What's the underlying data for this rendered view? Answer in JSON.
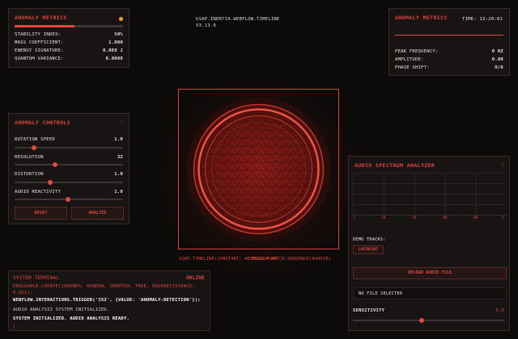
{
  "metrics_left": {
    "title": "Anomaly Metrics",
    "progress": 0.55,
    "rows": [
      {
        "label": "Stability Index:",
        "value": "50%"
      },
      {
        "label": "Mass Coefficient:",
        "value": "1.000"
      },
      {
        "label": "Energy Signature:",
        "value": "0.0E0 J"
      },
      {
        "label": "Quantum Variance:",
        "value": "0.0000"
      }
    ]
  },
  "header_center": {
    "line1": "GSAP.INERTIA.WEBFLOW.TIMELINE",
    "line2": "V3.13.0"
  },
  "metrics_right": {
    "title": "Anomaly Metrics",
    "time_label": "Time: 13:20:01",
    "rows": [
      {
        "label": "Peak Frequency:",
        "value": "0 Hz"
      },
      {
        "label": "Amplitude:",
        "value": "0.00"
      },
      {
        "label": "Phase Shift:",
        "value": "π/6"
      }
    ]
  },
  "controls": {
    "title": "Anomaly Controls",
    "grip": "⠿",
    "sliders": [
      {
        "label": "Rotation Speed",
        "value": "1.0",
        "fraction": 0.18
      },
      {
        "label": "Resolution",
        "value": "32",
        "fraction": 0.37
      },
      {
        "label": "Distortion",
        "value": "1.0",
        "fraction": 0.33
      },
      {
        "label": "Audio Reactivity",
        "value": "1.0",
        "fraction": 0.49
      }
    ],
    "reset_label": "Reset",
    "analyze_label": "Analyze"
  },
  "center_caption": {
    "left": "GSAP.TIMELINE({ONSTART: WEBFLOW.PLAY",
    "right": "TERLOW.MATCH.SEQUENCE(844F2E)"
  },
  "spectrum": {
    "title": "Audio Spectrum Analyzer",
    "grip": "⠿",
    "ticks": [
      "2",
      "1K",
      "2K",
      "4K",
      "8K",
      "1"
    ],
    "demo_label": "Demo Tracks:",
    "demo_track": "Lastnight",
    "upload_label": "Upload Audio File",
    "file_status": "No file selected",
    "sensitivity_label": "Sensitivity",
    "sensitivity_value": "5.0",
    "sensitivity_fraction": 0.45
  },
  "terminal": {
    "title": "System Terminal",
    "status": "Online",
    "lines": [
      {
        "text": "DRAGGABLE.CREATE({BOUNDS: WINDOW, INERTIA: TRUE, EDGERESISTANCE: 0.65});",
        "color": "#e0483c"
      },
      {
        "text": "WEBFLOW.INTERACTIONS.TRIGGER('IX2', {VALUE: 'ANOMALY-DETECTION'});",
        "color": "#ffffff"
      },
      {
        "text": "AUDIO ANALYSIS SYSTEM INITIALIZED.",
        "color": "#cfcfcf"
      },
      {
        "text": "SYSTEM INITIALIZED. AUDIO ANALYSIS READY.",
        "color": "#ffffff"
      }
    ],
    "cursor": "|"
  },
  "colors": {
    "accent": "#e0483c",
    "status_dot": "#f2a21a"
  }
}
